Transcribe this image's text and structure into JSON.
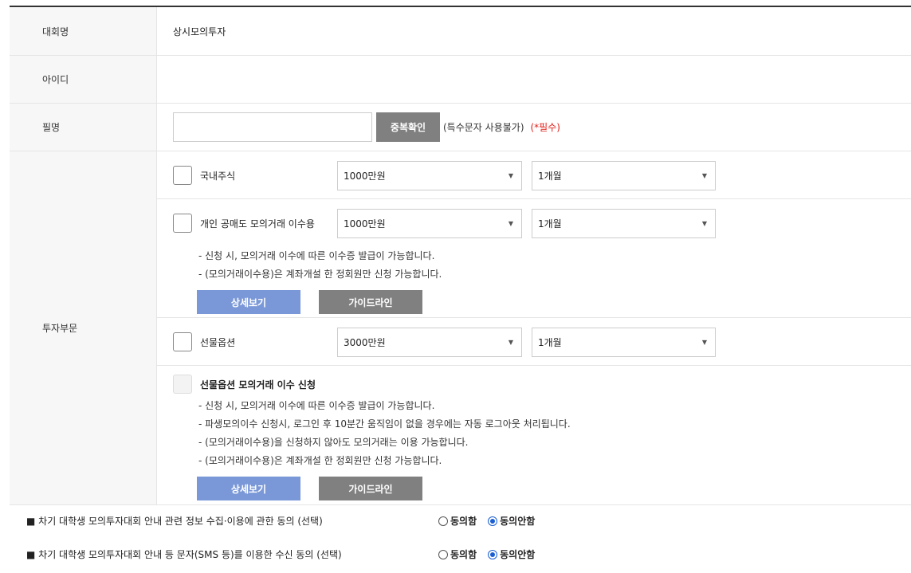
{
  "contest": {
    "label": "대회명",
    "value": "상시모의투자"
  },
  "id": {
    "label": "아이디",
    "value": ""
  },
  "nickname": {
    "label": "필명",
    "input_value": "",
    "check_button": "중복확인",
    "note": "(특수문자 사용불가)",
    "required": "(*필수)"
  },
  "invest": {
    "label": "투자부문",
    "domestic": {
      "label": "국내주식",
      "amount": "1000만원",
      "period": "1개월"
    },
    "short_sale": {
      "label": "개인 공매도 모의거래 이수용",
      "amount": "1000만원",
      "period": "1개월",
      "notes": [
        "- 신청 시, 모의거래 이수에 따른 이수증 발급이 가능합니다.",
        "- (모의거래이수용)은 계좌개설 한 정회원만 신청 가능합니다."
      ],
      "detail_button": "상세보기",
      "guide_button": "가이드라인"
    },
    "futures": {
      "label": "선물옵션",
      "amount": "3000만원",
      "period": "1개월"
    },
    "futures_apply": {
      "title": "선물옵션 모의거래 이수 신청",
      "notes": [
        "- 신청 시, 모의거래 이수에 따른 이수증 발급이 가능합니다.",
        "- 파생모의이수 신청시, 로그인 후 10분간 움직임이 없을 경우에는 자동 로그아웃 처리됩니다.",
        "- (모의거래이수용)을 신청하지 않아도 모의거래는 이용 가능합니다.",
        "- (모의거래이수용)은 계좌개설 한 정회원만 신청 가능합니다."
      ],
      "detail_button": "상세보기",
      "guide_button": "가이드라인"
    }
  },
  "consents": [
    {
      "text": "■ 차기 대학생 모의투자대회 안내 관련 정보 수집·이용에 관한 동의 (선택)",
      "agree": "동의함",
      "disagree": "동의안함",
      "selected": "disagree"
    },
    {
      "text": "■ 차기 대학생 모의투자대회 안내 등 문자(SMS 등)를 이용한 수신 동의 (선택)",
      "agree": "동의함",
      "disagree": "동의안함",
      "selected": "disagree"
    }
  ],
  "icons": {
    "dropdown": "▼",
    "arrow_name": "chevron-down-icon"
  },
  "colors": {
    "detail_button": "#7a98d8",
    "gray_button": "#808080",
    "required": "#e0211b",
    "radio_selected": "#1a5fd1"
  }
}
